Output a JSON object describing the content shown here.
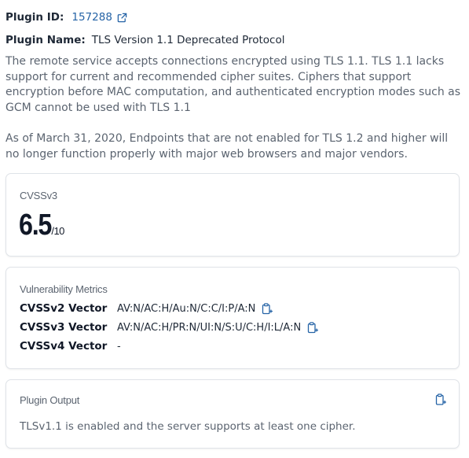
{
  "plugin": {
    "id_label": "Plugin ID:",
    "id_value": "157288",
    "name_label": "Plugin Name:",
    "name_value": "TLS Version 1.1 Deprecated Protocol"
  },
  "description": {
    "p1": "The remote service accepts connections encrypted using TLS 1.1. TLS 1.1 lacks support for current and recommended cipher suites. Ciphers that support encryption before MAC computation, and authenticated encryption modes such as GCM cannot be used with TLS 1.1",
    "p2": "As of March 31, 2020, Endpoints that are not enabled for TLS 1.2 and higher will no longer function properly with major web browsers and major vendors."
  },
  "cvss": {
    "label": "CVSSv3",
    "score": "6.5",
    "max": "/10"
  },
  "metrics": {
    "title": "Vulnerability Metrics",
    "rows": [
      {
        "label": "CVSSv2 Vector",
        "value": "AV:N/AC:H/Au:N/C:C/I:P/A:N"
      },
      {
        "label": "CVSSv3 Vector",
        "value": "AV:N/AC:H/PR:N/UI:N/S:U/C:H/I:L/A:N"
      },
      {
        "label": "CVSSv4 Vector",
        "value": "-"
      }
    ]
  },
  "output": {
    "title": "Plugin Output",
    "text": "TLSv1.1 is enabled and the server supports at least one cipher."
  },
  "colors": {
    "link": "#2563a6",
    "muted_text": "#5b6470",
    "card_border": "#dfe3e8"
  },
  "icons": {
    "external_link": "external-link-icon",
    "copy": "clipboard-copy-icon"
  }
}
